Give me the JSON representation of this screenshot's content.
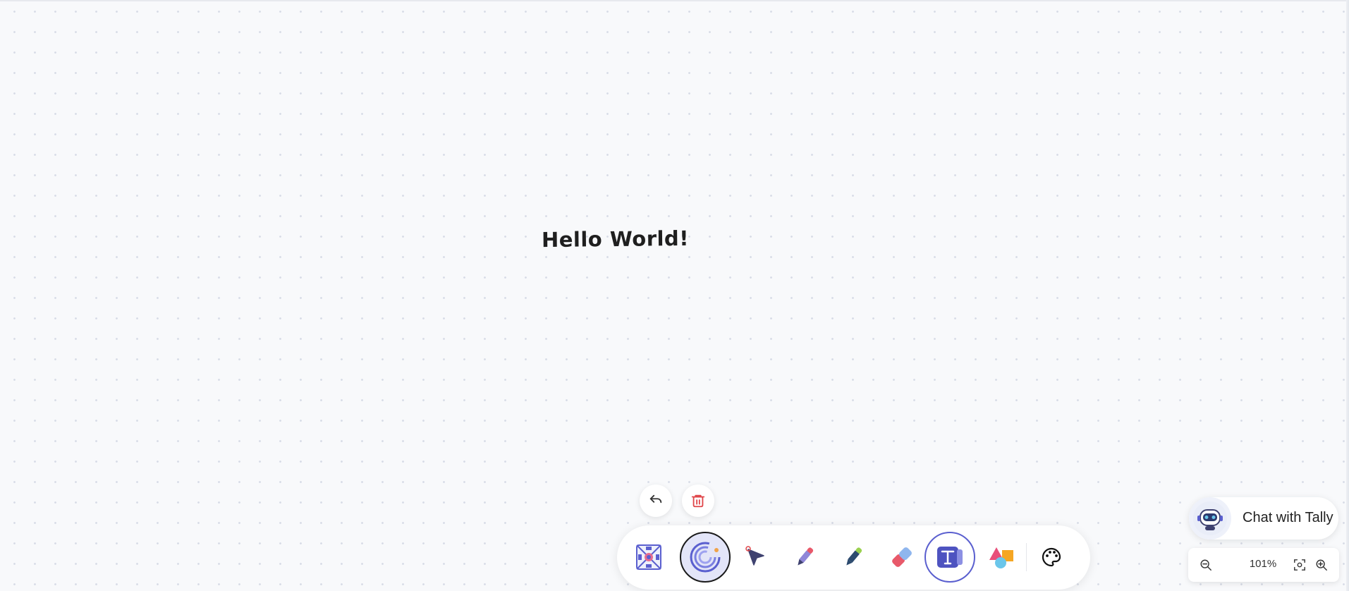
{
  "canvas": {
    "text": "Hello World!"
  },
  "actions": {
    "undo_icon": "undo-icon",
    "delete_icon": "trash-icon"
  },
  "toolbar": {
    "tools": [
      {
        "name": "ai-tool",
        "icon": "mosaic-icon"
      },
      {
        "name": "laser-tool",
        "icon": "spiral-icon",
        "selected": true
      },
      {
        "name": "select-tool",
        "icon": "cursor-icon"
      },
      {
        "name": "pen-tool",
        "icon": "pen-icon"
      },
      {
        "name": "highlighter-tool",
        "icon": "highlighter-icon"
      },
      {
        "name": "eraser-tool",
        "icon": "eraser-icon"
      },
      {
        "name": "text-tool",
        "icon": "text-icon",
        "active": true
      },
      {
        "name": "shapes-tool",
        "icon": "shapes-icon"
      },
      {
        "name": "color-tool",
        "icon": "palette-icon"
      }
    ]
  },
  "chat": {
    "label": "Chat with Tally",
    "avatar_icon": "robot-icon"
  },
  "zoom": {
    "level": "101%",
    "zoom_out_icon": "zoom-out-icon",
    "fit_icon": "fit-screen-icon",
    "zoom_in_icon": "zoom-in-icon"
  },
  "colors": {
    "accent": "#5a5fcf",
    "danger": "#e0464a",
    "background": "#f8f9fb"
  }
}
